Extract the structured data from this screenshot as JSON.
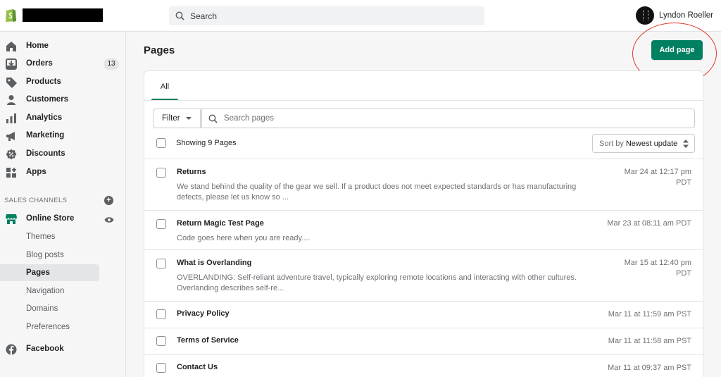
{
  "topbar": {
    "search_placeholder": "Search",
    "user_name": "Lyndon Roeller"
  },
  "sidebar": {
    "items": [
      {
        "label": "Home",
        "icon": "home-icon"
      },
      {
        "label": "Orders",
        "icon": "orders-icon",
        "badge": "13"
      },
      {
        "label": "Products",
        "icon": "tag-icon"
      },
      {
        "label": "Customers",
        "icon": "person-icon"
      },
      {
        "label": "Analytics",
        "icon": "bar-chart-icon"
      },
      {
        "label": "Marketing",
        "icon": "megaphone-icon"
      },
      {
        "label": "Discounts",
        "icon": "discount-icon"
      },
      {
        "label": "Apps",
        "icon": "apps-icon"
      }
    ],
    "sales_channels_label": "SALES CHANNELS",
    "online_store": {
      "label": "Online Store",
      "icon": "store-icon"
    },
    "sub_items": [
      {
        "label": "Themes"
      },
      {
        "label": "Blog posts"
      },
      {
        "label": "Pages",
        "active": true
      },
      {
        "label": "Navigation"
      },
      {
        "label": "Domains"
      },
      {
        "label": "Preferences"
      }
    ],
    "facebook": {
      "label": "Facebook",
      "icon": "facebook-icon"
    }
  },
  "main": {
    "title": "Pages",
    "add_button": "Add page",
    "tabs": [
      {
        "label": "All",
        "active": true
      }
    ],
    "filter_label": "Filter",
    "search_placeholder": "Search pages",
    "showing": "Showing 9 Pages",
    "sort_label": "Sort by",
    "sort_value": "Newest update",
    "rows": [
      {
        "title": "Returns",
        "desc": "We stand behind the quality of the gear we sell. If a product does not meet expected standards or has manufacturing defects, please let us know so ...",
        "date_line1": "Mar 24 at 12:17 pm",
        "date_line2": "PDT"
      },
      {
        "title": "Return Magic Test Page",
        "desc": "Code goes here when you are ready....",
        "date_line1": "Mar 23 at 08:11 am PDT",
        "date_line2": ""
      },
      {
        "title": "What is Overlanding",
        "desc": "OVERLANDING: Self-reliant adventure travel, typically exploring remote locations and interacting with other cultures. Overlanding describes self-re...",
        "date_line1": "Mar 15 at 12:40 pm",
        "date_line2": "PDT"
      },
      {
        "title": "Privacy Policy",
        "desc": "",
        "date_line1": "Mar 11 at 11:59 am PST",
        "date_line2": ""
      },
      {
        "title": "Terms of Service",
        "desc": "",
        "date_line1": "Mar 11 at 11:58 am PST",
        "date_line2": ""
      },
      {
        "title": "Contact Us",
        "desc": "",
        "date_line1": "Mar 11 at 09:37 am PST",
        "date_line2": ""
      }
    ]
  },
  "colors": {
    "accent_green": "#008060",
    "highlight_circle": "#e03b2a"
  }
}
